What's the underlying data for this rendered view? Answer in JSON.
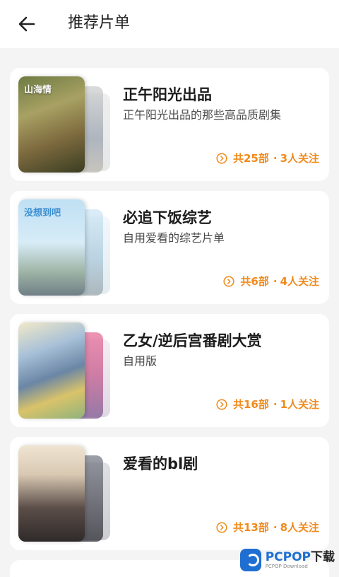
{
  "header": {
    "back_icon": "arrow-left-icon",
    "title": "推荐片单"
  },
  "colors": {
    "accent": "#f08a1c",
    "background": "#f4f4f5",
    "card": "#ffffff"
  },
  "lists": [
    {
      "title": "正午阳光出品",
      "subtitle": "正午阳光出品的那些高品质剧集",
      "cover_caption": "山海情",
      "count": "共25部",
      "followers": "3人关注"
    },
    {
      "title": "必追下饭综艺",
      "subtitle": "自用爱看的综艺片单",
      "cover_caption": "没想到吧",
      "count": "共6部",
      "followers": "4人关注"
    },
    {
      "title": "乙女/逆后宫番剧大赏",
      "subtitle": "自用版",
      "cover_caption": "",
      "count": "共16部",
      "followers": "1人关注"
    },
    {
      "title": "爱看的bl剧",
      "subtitle": "",
      "cover_caption": "",
      "count": "共13部",
      "followers": "8人关注"
    }
  ],
  "watermark": {
    "brand": "PCPOP",
    "suffix": "下载",
    "sub": "PCPOP Download"
  }
}
